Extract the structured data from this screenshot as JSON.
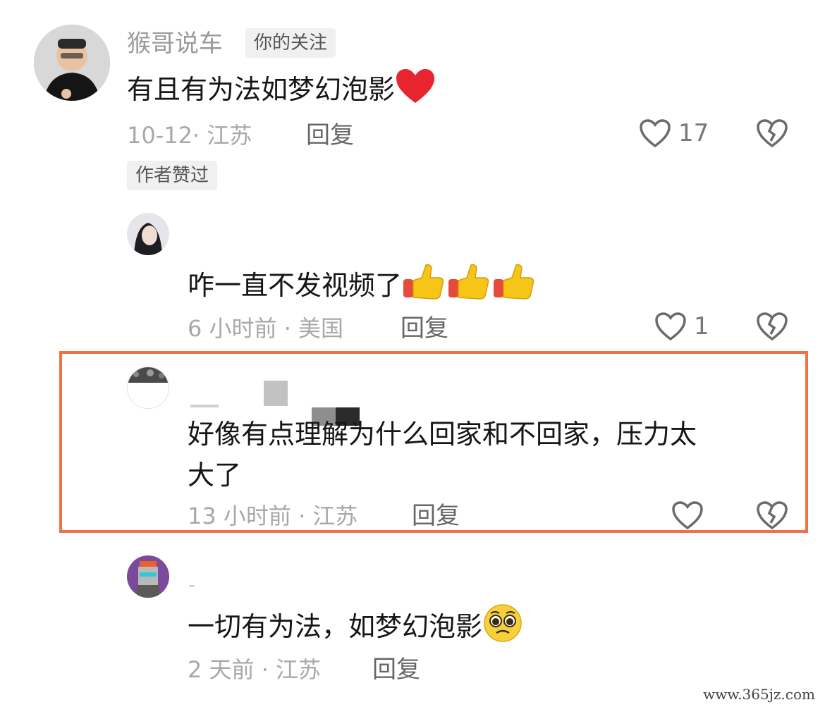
{
  "comments": [
    {
      "username": "猴哥说车",
      "badge": "你的关注",
      "text": "有且有为法如梦幻泡影",
      "emoji": "red-heart-icon",
      "date": "10-12· 江苏",
      "reply": "回复",
      "likes": "17",
      "author_badge": "作者赞过"
    },
    {
      "username": "",
      "text": "咋一直不发视频了",
      "emoji": "thumbs-up-icon",
      "date": "6 小时前 · 美国",
      "reply": "回复",
      "likes": "1"
    },
    {
      "username": "",
      "text_line1": "好像有点理解为什么回家和不回家，压力太",
      "text_line2": "大了",
      "date": "13 小时前 · 江苏",
      "reply": "回复",
      "likes": ""
    },
    {
      "username": "",
      "text": "一切有为法，如梦幻泡影",
      "emoji": "pleading-face-icon",
      "date": "2 天前 · 江苏",
      "reply": "回复"
    }
  ],
  "watermark": "www.365jz.com",
  "colors": {
    "highlight": "#ee7244",
    "heart": "#e8242e",
    "thumb": "#f5c518"
  }
}
